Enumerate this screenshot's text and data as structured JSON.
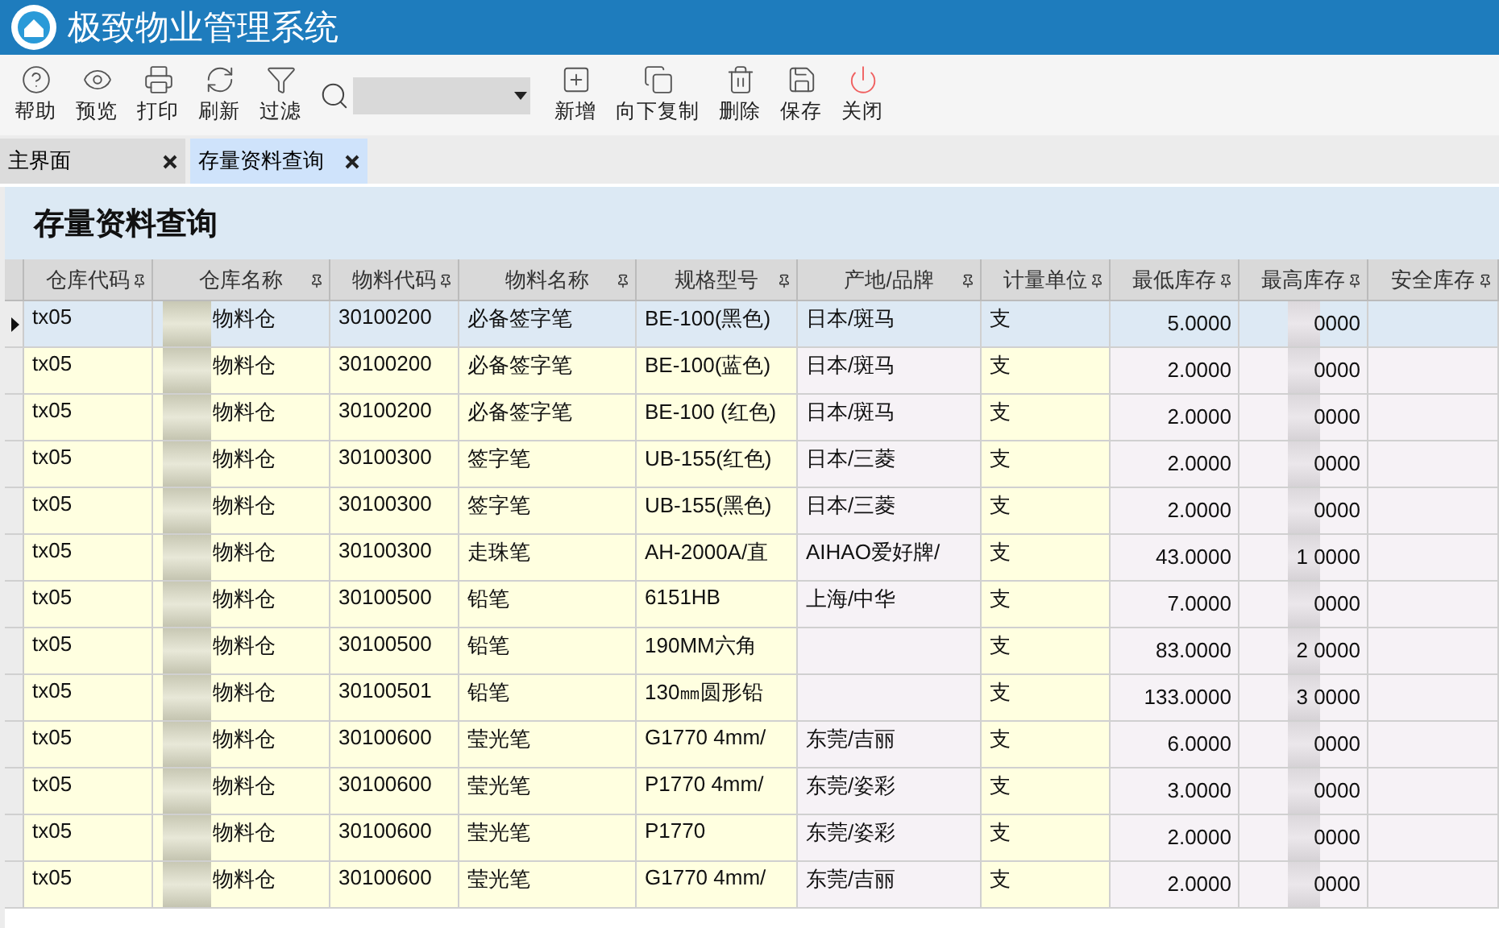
{
  "window": {
    "title": "极致物业管理系统"
  },
  "toolbar": [
    {
      "label": "帮助"
    },
    {
      "label": "预览"
    },
    {
      "label": "打印"
    },
    {
      "label": "刷新"
    },
    {
      "label": "过滤"
    },
    {
      "kind": "search"
    },
    {
      "label": "新增"
    },
    {
      "label": "向下复制"
    },
    {
      "label": "删除"
    },
    {
      "label": "保存"
    },
    {
      "label": "关闭"
    }
  ],
  "tabs": [
    {
      "label": "主界面",
      "selected": false
    },
    {
      "label": "存量资料查询",
      "selected": true
    }
  ],
  "page_title": "存量资料查询",
  "table": {
    "columns": [
      {
        "label": "仓库代码",
        "kind": "yellow"
      },
      {
        "label": "仓库名称",
        "kind": "yellow"
      },
      {
        "label": "物料代码",
        "kind": "yellow"
      },
      {
        "label": "物料名称",
        "kind": "yellow"
      },
      {
        "label": "规格型号",
        "kind": "yellow"
      },
      {
        "label": "产地/品牌",
        "kind": "lavender"
      },
      {
        "label": "计量单位",
        "kind": "yellow"
      },
      {
        "label": "最低库存",
        "kind": "lavender"
      },
      {
        "label": "最高库存",
        "kind": "lavender"
      },
      {
        "label": "安全库存",
        "kind": "lavender"
      }
    ],
    "rows": [
      {
        "selected": true,
        "cells": [
          "tx05",
          "物料仓",
          "30100200",
          "必备签字笔",
          "BE-100(黑色)",
          "日本/斑马",
          "支",
          "5.0000",
          "0000",
          ""
        ]
      },
      {
        "selected": false,
        "cells": [
          "tx05",
          "物料仓",
          "30100200",
          "必备签字笔",
          "BE-100(蓝色)",
          "日本/斑马",
          "支",
          "2.0000",
          "0000",
          ""
        ]
      },
      {
        "selected": false,
        "cells": [
          "tx05",
          "物料仓",
          "30100200",
          "必备签字笔",
          "BE-100 (红色)",
          "日本/斑马",
          "支",
          "2.0000",
          "0000",
          ""
        ]
      },
      {
        "selected": false,
        "cells": [
          "tx05",
          "物料仓",
          "30100300",
          "签字笔",
          " UB-155(红色)",
          "日本/三菱",
          "支",
          "2.0000",
          "0000",
          ""
        ]
      },
      {
        "selected": false,
        "cells": [
          "tx05",
          "物料仓",
          "30100300",
          "签字笔",
          " UB-155(黑色)",
          "日本/三菱",
          "支",
          "2.0000",
          "0000",
          ""
        ]
      },
      {
        "selected": false,
        "cells": [
          "tx05",
          "物料仓",
          "30100300",
          "走珠笔",
          "AH-2000A/直",
          "AIHAO爱好牌/",
          "支",
          "43.0000",
          "1   0000",
          ""
        ]
      },
      {
        "selected": false,
        "cells": [
          "tx05",
          "物料仓",
          "30100500",
          "铅笔",
          "6151HB",
          "上海/中华",
          "支",
          "7.0000",
          "0000",
          ""
        ]
      },
      {
        "selected": false,
        "cells": [
          "tx05",
          "物料仓",
          "30100500",
          "铅笔",
          "190MM六角",
          "",
          "支",
          "83.0000",
          "2   0000",
          ""
        ]
      },
      {
        "selected": false,
        "cells": [
          "tx05",
          "物料仓",
          "30100501",
          "铅笔",
          "130㎜圆形铅",
          "",
          "支",
          "133.0000",
          "3   0000",
          ""
        ]
      },
      {
        "selected": false,
        "cells": [
          "tx05",
          "物料仓",
          "30100600",
          "莹光笔",
          "G1770 4mm/",
          "东莞/吉丽",
          "支",
          "6.0000",
          "0000",
          ""
        ]
      },
      {
        "selected": false,
        "cells": [
          "tx05",
          "物料仓",
          "30100600",
          "莹光笔",
          " P1770 4mm/",
          "东莞/姿彩",
          "支",
          "3.0000",
          "0000",
          ""
        ]
      },
      {
        "selected": false,
        "cells": [
          "tx05",
          "物料仓",
          "30100600",
          "莹光笔",
          " P1770",
          "东莞/姿彩",
          "支",
          "2.0000",
          "0000",
          ""
        ]
      },
      {
        "selected": false,
        "cells": [
          "tx05",
          "物料仓",
          "30100600",
          "莹光笔",
          " G1770 4mm/",
          "东莞/吉丽",
          "支",
          "2.0000",
          "0000",
          ""
        ]
      }
    ]
  }
}
